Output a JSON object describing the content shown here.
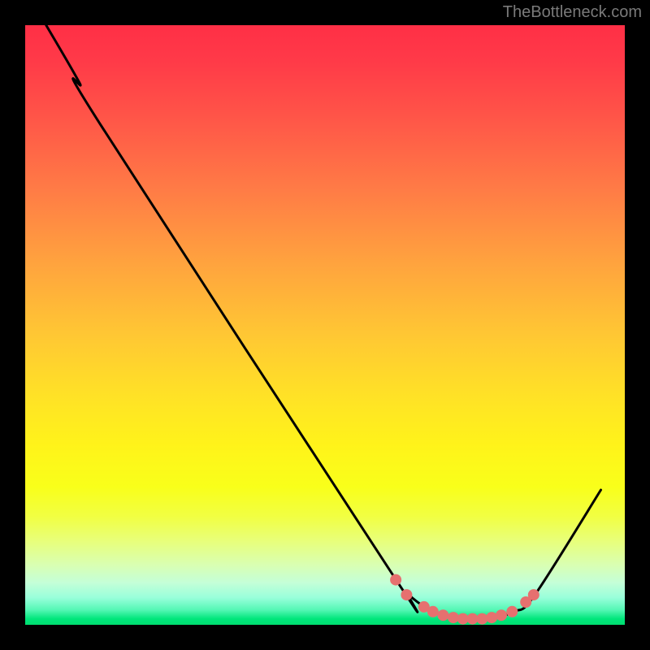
{
  "attribution": "TheBottleneck.com",
  "chart_data": {
    "type": "line",
    "title": "",
    "xlabel": "",
    "ylabel": "",
    "xlim": [
      0,
      1
    ],
    "ylim": [
      0,
      1
    ],
    "series": [
      {
        "name": "curve",
        "points": [
          [
            0.035,
            1.0
          ],
          [
            0.09,
            0.905
          ],
          [
            0.125,
            0.835
          ],
          [
            0.61,
            0.088
          ],
          [
            0.64,
            0.05
          ],
          [
            0.68,
            0.022
          ],
          [
            0.72,
            0.01
          ],
          [
            0.77,
            0.01
          ],
          [
            0.815,
            0.022
          ],
          [
            0.85,
            0.05
          ],
          [
            0.96,
            0.225
          ]
        ]
      }
    ],
    "markers": [
      {
        "x": 0.618,
        "y": 0.075
      },
      {
        "x": 0.636,
        "y": 0.05
      },
      {
        "x": 0.665,
        "y": 0.03
      },
      {
        "x": 0.68,
        "y": 0.022
      },
      {
        "x": 0.697,
        "y": 0.016
      },
      {
        "x": 0.714,
        "y": 0.012
      },
      {
        "x": 0.73,
        "y": 0.01
      },
      {
        "x": 0.746,
        "y": 0.01
      },
      {
        "x": 0.762,
        "y": 0.01
      },
      {
        "x": 0.778,
        "y": 0.012
      },
      {
        "x": 0.794,
        "y": 0.016
      },
      {
        "x": 0.812,
        "y": 0.022
      },
      {
        "x": 0.835,
        "y": 0.038
      },
      {
        "x": 0.848,
        "y": 0.05
      }
    ],
    "gradient_stops": [
      {
        "pos": 0.0,
        "color": "#ff2f46"
      },
      {
        "pos": 0.5,
        "color": "#ffd030"
      },
      {
        "pos": 0.8,
        "color": "#f4ff30"
      },
      {
        "pos": 1.0,
        "color": "#00df70"
      }
    ]
  }
}
